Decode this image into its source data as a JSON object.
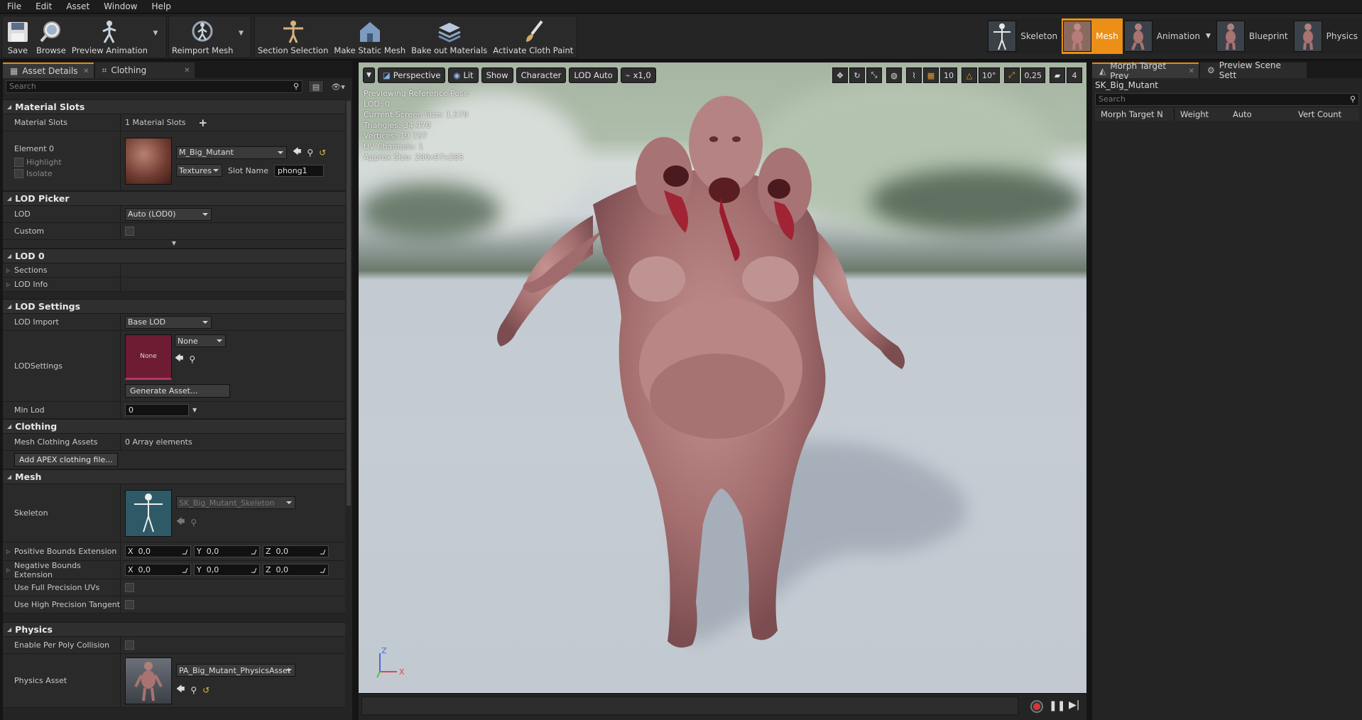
{
  "menu": [
    "File",
    "Edit",
    "Asset",
    "Window",
    "Help"
  ],
  "toolbar": {
    "save": "Save",
    "browse": "Browse",
    "preview_animation": "Preview Animation",
    "reimport_mesh": "Reimport Mesh",
    "section_selection": "Section Selection",
    "make_static_mesh": "Make Static Mesh",
    "bake_out_materials": "Bake out Materials",
    "activate_cloth_paint": "Activate Cloth Paint"
  },
  "modes": {
    "skeleton": "Skeleton",
    "mesh": "Mesh",
    "animation": "Animation",
    "blueprint": "Blueprint",
    "physics": "Physics",
    "active_color": "#ec8f16"
  },
  "left_panel": {
    "tab_asset_details": "Asset Details",
    "tab_clothing": "Clothing",
    "search_placeholder": "Search",
    "material_slots": {
      "header": "Material Slots",
      "label": "Material Slots",
      "count": "1 Material Slots",
      "element": "Element 0",
      "highlight": "Highlight",
      "isolate": "Isolate",
      "material_name": "M_Big_Mutant",
      "textures": "Textures",
      "slot_name_label": "Slot Name",
      "slot_name_value": "phong1"
    },
    "lod_picker": {
      "header": "LOD Picker",
      "lod_label": "LOD",
      "lod_value": "Auto (LOD0)",
      "custom_label": "Custom"
    },
    "lod0": {
      "header": "LOD 0",
      "sections": "Sections",
      "lod_info": "LOD Info"
    },
    "lod_settings": {
      "header": "LOD Settings",
      "lod_import_label": "LOD Import",
      "lod_import_value": "Base LOD",
      "lodsettings_label": "LODSettings",
      "thumb_text": "None",
      "combo_value": "None",
      "generate_asset": "Generate Asset...",
      "min_lod_label": "Min Lod",
      "min_lod_value": "0"
    },
    "clothing": {
      "header": "Clothing",
      "assets_label": "Mesh Clothing Assets",
      "assets_value": "0 Array elements",
      "add_button": "Add APEX clothing file..."
    },
    "mesh": {
      "header": "Mesh",
      "skeleton_label": "Skeleton",
      "skeleton_value": "SK_Big_Mutant_Skeleton",
      "pos_bounds_label": "Positive Bounds Extension",
      "neg_bounds_label": "Negative Bounds Extension",
      "x": "X",
      "y": "Y",
      "z": "Z",
      "zero": "0,0",
      "full_precision_uvs": "Use Full Precision UVs",
      "high_precision_tangent": "Use High Precision Tangent B"
    },
    "physics": {
      "header": "Physics",
      "per_poly_label": "Enable Per Poly Collision",
      "asset_label": "Physics Asset",
      "asset_value": "PA_Big_Mutant_PhysicsAsset"
    }
  },
  "viewport": {
    "perspective": "Perspective",
    "lit": "Lit",
    "show": "Show",
    "character": "Character",
    "lod_auto": "LOD Auto",
    "speed": "x1,0",
    "grid_snap": "10",
    "rot_snap": "10°",
    "scale_snap": "0,25",
    "cam_speed": "4",
    "stats": [
      "Previewing Reference Pose",
      "LOD: 0",
      "Current Screen Size: 1,579",
      "Triangles: 34 470",
      "Vertices: 19 737",
      "UV Channels: 1",
      "Approx Size: 286x97x285"
    ]
  },
  "right_panel": {
    "tab_morph": "Morph Target Prev",
    "tab_scene": "Preview Scene Sett",
    "mesh_name": "SK_Big_Mutant",
    "search_placeholder": "Search",
    "columns": [
      "Morph Target N",
      "Weight",
      "Auto",
      "Vert Count"
    ]
  }
}
